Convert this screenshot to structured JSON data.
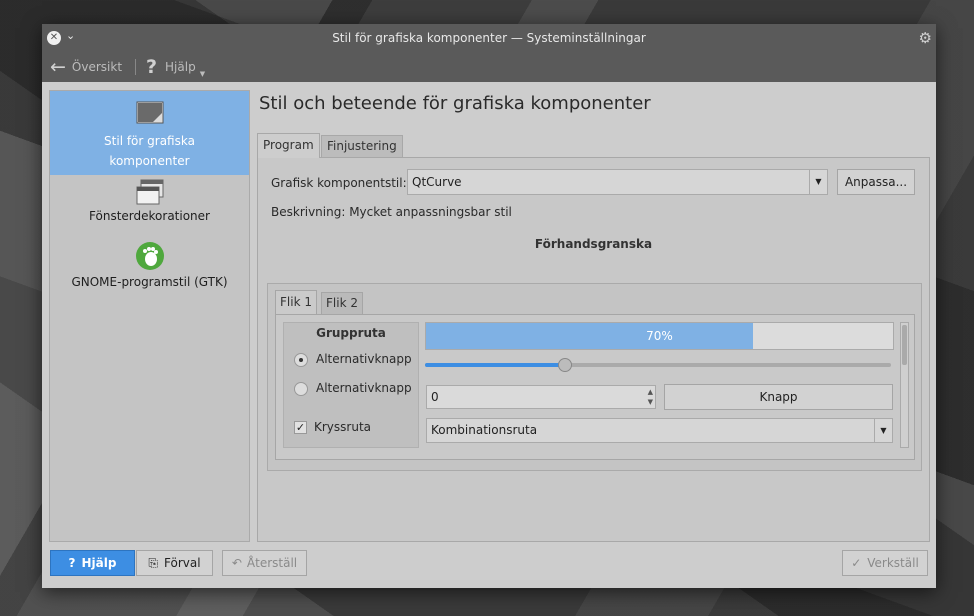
{
  "window": {
    "title": "Stil för grafiska komponenter  — Systeminställningar"
  },
  "toolbar": {
    "back_label": "Översikt",
    "help_label": "Hjälp"
  },
  "sidebar": {
    "items": [
      {
        "label": "Stil för grafiska komponenter",
        "icon": "widget-style-icon",
        "selected": true
      },
      {
        "label": "Fönsterdekorationer",
        "icon": "window-decorations-icon",
        "selected": false
      },
      {
        "label": "GNOME-programstil (GTK)",
        "icon": "gnome-foot-icon",
        "selected": false
      }
    ]
  },
  "main": {
    "heading": "Stil och beteende för grafiska komponenter",
    "tabs": [
      {
        "label": "Program",
        "active": true
      },
      {
        "label": "Finjustering",
        "active": false
      }
    ],
    "widget_style_label": "Grafisk komponentstil:",
    "widget_style_value": "QtCurve",
    "customize_button": "Anpassa...",
    "description": "Beskrivning: Mycket anpassningsbar stil",
    "preview": {
      "title": "Förhandsgranska",
      "tabs": [
        {
          "label": "Flik 1",
          "active": true
        },
        {
          "label": "Flik 2",
          "active": false
        }
      ],
      "groupbox_title": "Gruppruta",
      "radio1_label": "Alternativknapp",
      "radio1_checked": true,
      "radio2_label": "Alternativknapp",
      "radio2_checked": false,
      "checkbox_label": "Kryssruta",
      "checkbox_checked": true,
      "progress_text": "70%",
      "progress_value": 0.7,
      "slider_value": 0.3,
      "spin_value": "0",
      "push_button": "Knapp",
      "combo_value": "Kombinationsruta"
    }
  },
  "footer": {
    "help_button": "Hjälp",
    "defaults_button": "Förval",
    "reset_button": "Återställ",
    "apply_button": "Verkställ"
  },
  "colors": {
    "accent": "#3d8ee3",
    "selection": "#7fb1e4",
    "titlebar": "#5a5a5a"
  }
}
